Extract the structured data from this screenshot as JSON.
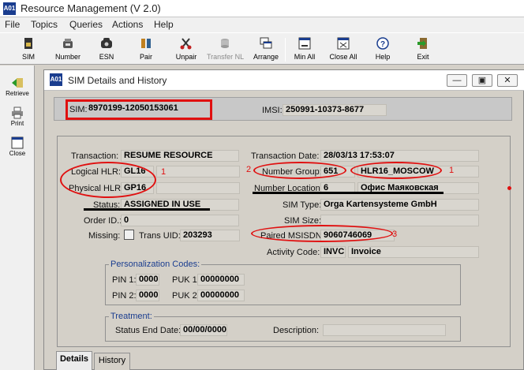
{
  "app": {
    "title": "Resource Management  (V 2.0)",
    "logo_text": "A01"
  },
  "menu": [
    "File",
    "Topics",
    "Queries",
    "Actions",
    "Help"
  ],
  "toolbar": {
    "sim": "SIM",
    "number": "Number",
    "esn": "ESN",
    "pair": "Pair",
    "unpair": "Unpair",
    "transfer_nl": "Transfer NL",
    "arrange": "Arrange",
    "min_all": "Min All",
    "close_all": "Close All",
    "help": "Help",
    "exit": "Exit"
  },
  "leftbar": {
    "retrieve": "Retrieve",
    "print": "Print",
    "close": "Close"
  },
  "window": {
    "title": "SIM Details and History",
    "sim_label": "SIM:",
    "sim_value": "8970199-12050153061",
    "imsi_label": "IMSI:",
    "imsi_value": "250991-10373-8677"
  },
  "details": {
    "transaction_label": "Transaction:",
    "transaction_value": "RESUME RESOURCE",
    "transaction_date_label": "Transaction Date:",
    "transaction_date_value": "28/03/13 17:53:07",
    "logical_hlr_label": "Logical HLR:",
    "logical_hlr_value": "GL16",
    "number_group_label": "Number Group:",
    "number_group_value": "651",
    "number_group_name": "HLR16_MOSCOW",
    "physical_hlr_label": "Physical HLR:",
    "physical_hlr_value": "GP16",
    "number_location_label": "Number Location:",
    "number_location_value": "6",
    "number_location_name": "Офис Маяковская",
    "status_label": "Status:",
    "status_value": "ASSIGNED IN USE",
    "sim_type_label": "SIM Type:",
    "sim_type_value": "Orga Kartensysteme GmbH",
    "order_id_label": "Order ID.:",
    "order_id_value": "0",
    "sim_size_label": "SIM Size:",
    "sim_size_value": "",
    "missing_label": "Missing:",
    "trans_uid_label": "Trans UID:",
    "trans_uid_value": "203293",
    "paired_msisdn_label": "Paired MSISDN:",
    "paired_msisdn_value": "9060746069",
    "activity_code_label": "Activity Code:",
    "activity_code_value": "INVC",
    "activity_code_name": "Invoice"
  },
  "annotations": {
    "n1": "1",
    "n2": "2",
    "n3": "3"
  },
  "personalization": {
    "title": "Personalization Codes:",
    "pin1_label": "PIN 1:",
    "pin1_value": "0000",
    "puk1_label": "PUK 1:",
    "puk1_value": "00000000",
    "pin2_label": "PIN 2:",
    "pin2_value": "0000",
    "puk2_label": "PUK 2:",
    "puk2_value": "00000000"
  },
  "treatment": {
    "title": "Treatment:",
    "status_end_date_label": "Status End Date:",
    "status_end_date_value": "00/00/0000",
    "description_label": "Description:",
    "description_value": ""
  },
  "tabs": {
    "details": "Details",
    "history": "History"
  },
  "colors": {
    "annotation_red": "#e01010",
    "group_title_blue": "#1a3d8f"
  }
}
